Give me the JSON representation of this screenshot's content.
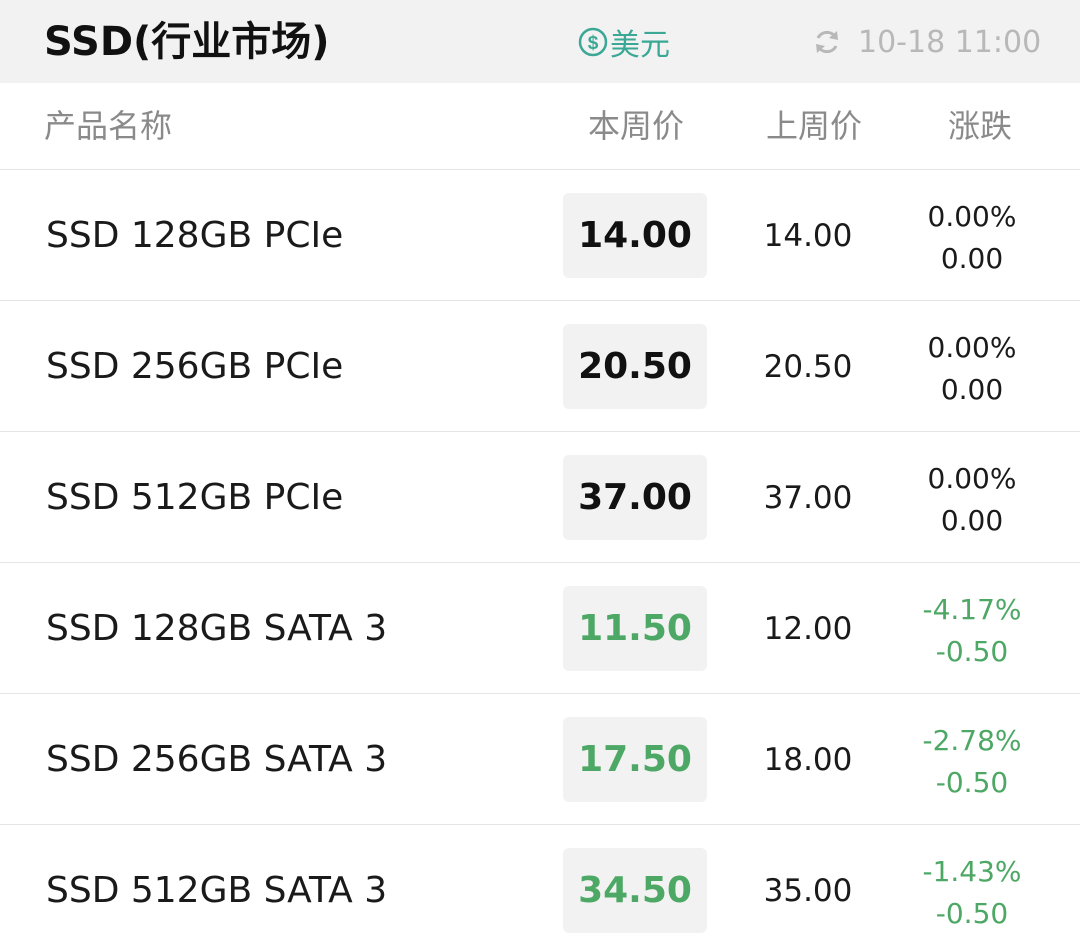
{
  "header": {
    "title": "SSD(行业市场)",
    "currency_label": "美元",
    "currency_icon": "dollar-coin-icon",
    "refresh_icon": "refresh-icon",
    "timestamp": "10-18 11:00"
  },
  "columns": {
    "name": "产品名称",
    "current_price": "本周价",
    "previous_price": "上周价",
    "change": "涨跌"
  },
  "colors": {
    "accent_teal": "#3aa894",
    "down_green": "#4ea865",
    "neutral_text": "#1a1a1a",
    "muted_text": "#8a8a8a"
  },
  "rows": [
    {
      "name": "SSD 128GB PCIe",
      "current": "14.00",
      "previous": "14.00",
      "change_pct": "0.00%",
      "change_abs": "0.00",
      "trend": "flat"
    },
    {
      "name": "SSD 256GB PCIe",
      "current": "20.50",
      "previous": "20.50",
      "change_pct": "0.00%",
      "change_abs": "0.00",
      "trend": "flat"
    },
    {
      "name": "SSD 512GB PCIe",
      "current": "37.00",
      "previous": "37.00",
      "change_pct": "0.00%",
      "change_abs": "0.00",
      "trend": "flat"
    },
    {
      "name": "SSD 128GB SATA 3",
      "current": "11.50",
      "previous": "12.00",
      "change_pct": "-4.17%",
      "change_abs": "-0.50",
      "trend": "down"
    },
    {
      "name": "SSD 256GB SATA 3",
      "current": "17.50",
      "previous": "18.00",
      "change_pct": "-2.78%",
      "change_abs": "-0.50",
      "trend": "down"
    },
    {
      "name": "SSD 512GB SATA 3",
      "current": "34.50",
      "previous": "35.00",
      "change_pct": "-1.43%",
      "change_abs": "-0.50",
      "trend": "down"
    }
  ]
}
